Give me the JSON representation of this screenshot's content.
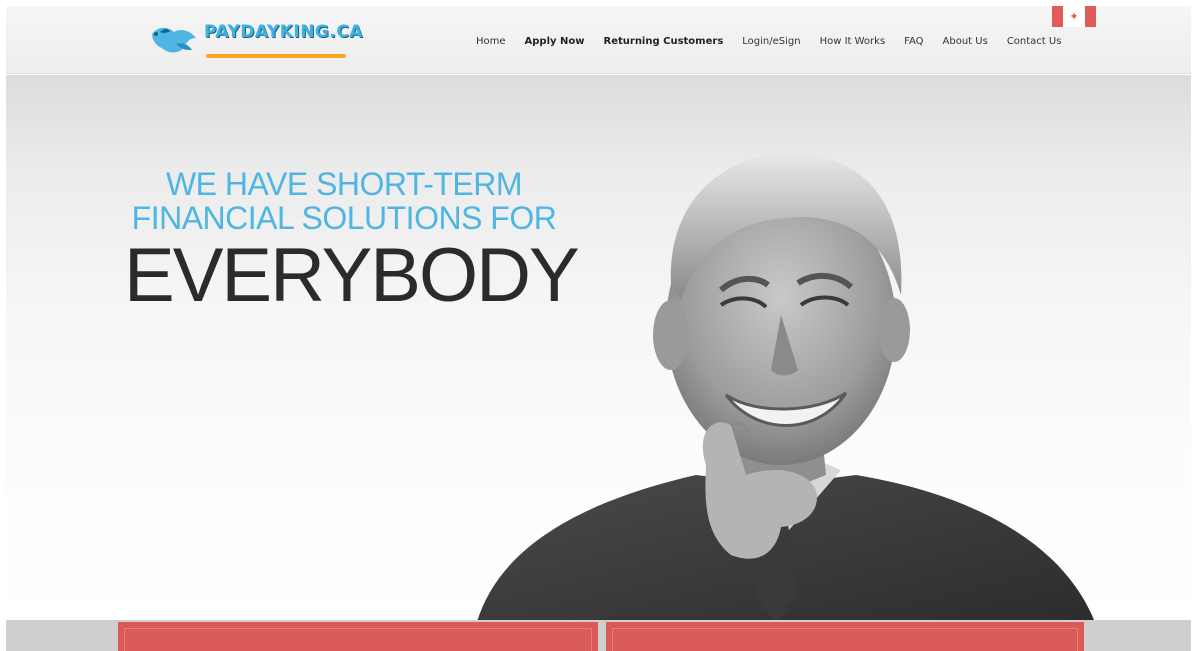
{
  "header": {
    "logo_text": "PAYDAYKING.CA",
    "nav": [
      {
        "label": "Home",
        "bold": false
      },
      {
        "label": "Apply Now",
        "bold": true
      },
      {
        "label": "Returning Customers",
        "bold": true
      },
      {
        "label": "Login/eSign",
        "bold": false
      },
      {
        "label": "How It Works",
        "bold": false
      },
      {
        "label": "FAQ",
        "bold": false
      },
      {
        "label": "About Us",
        "bold": false
      },
      {
        "label": "Contact Us",
        "bold": false
      }
    ],
    "flag_icon": "canada-flag-icon"
  },
  "hero": {
    "line1": "WE HAVE SHORT-TERM",
    "line2": "FINANCIAL SOLUTIONS FOR",
    "line3": "EVERYBODY"
  },
  "colors": {
    "accent_blue": "#4fb6e3",
    "logo_orange": "#f5a623",
    "cta_red": "#d95a57",
    "headline_dark": "#2b2b2b"
  }
}
